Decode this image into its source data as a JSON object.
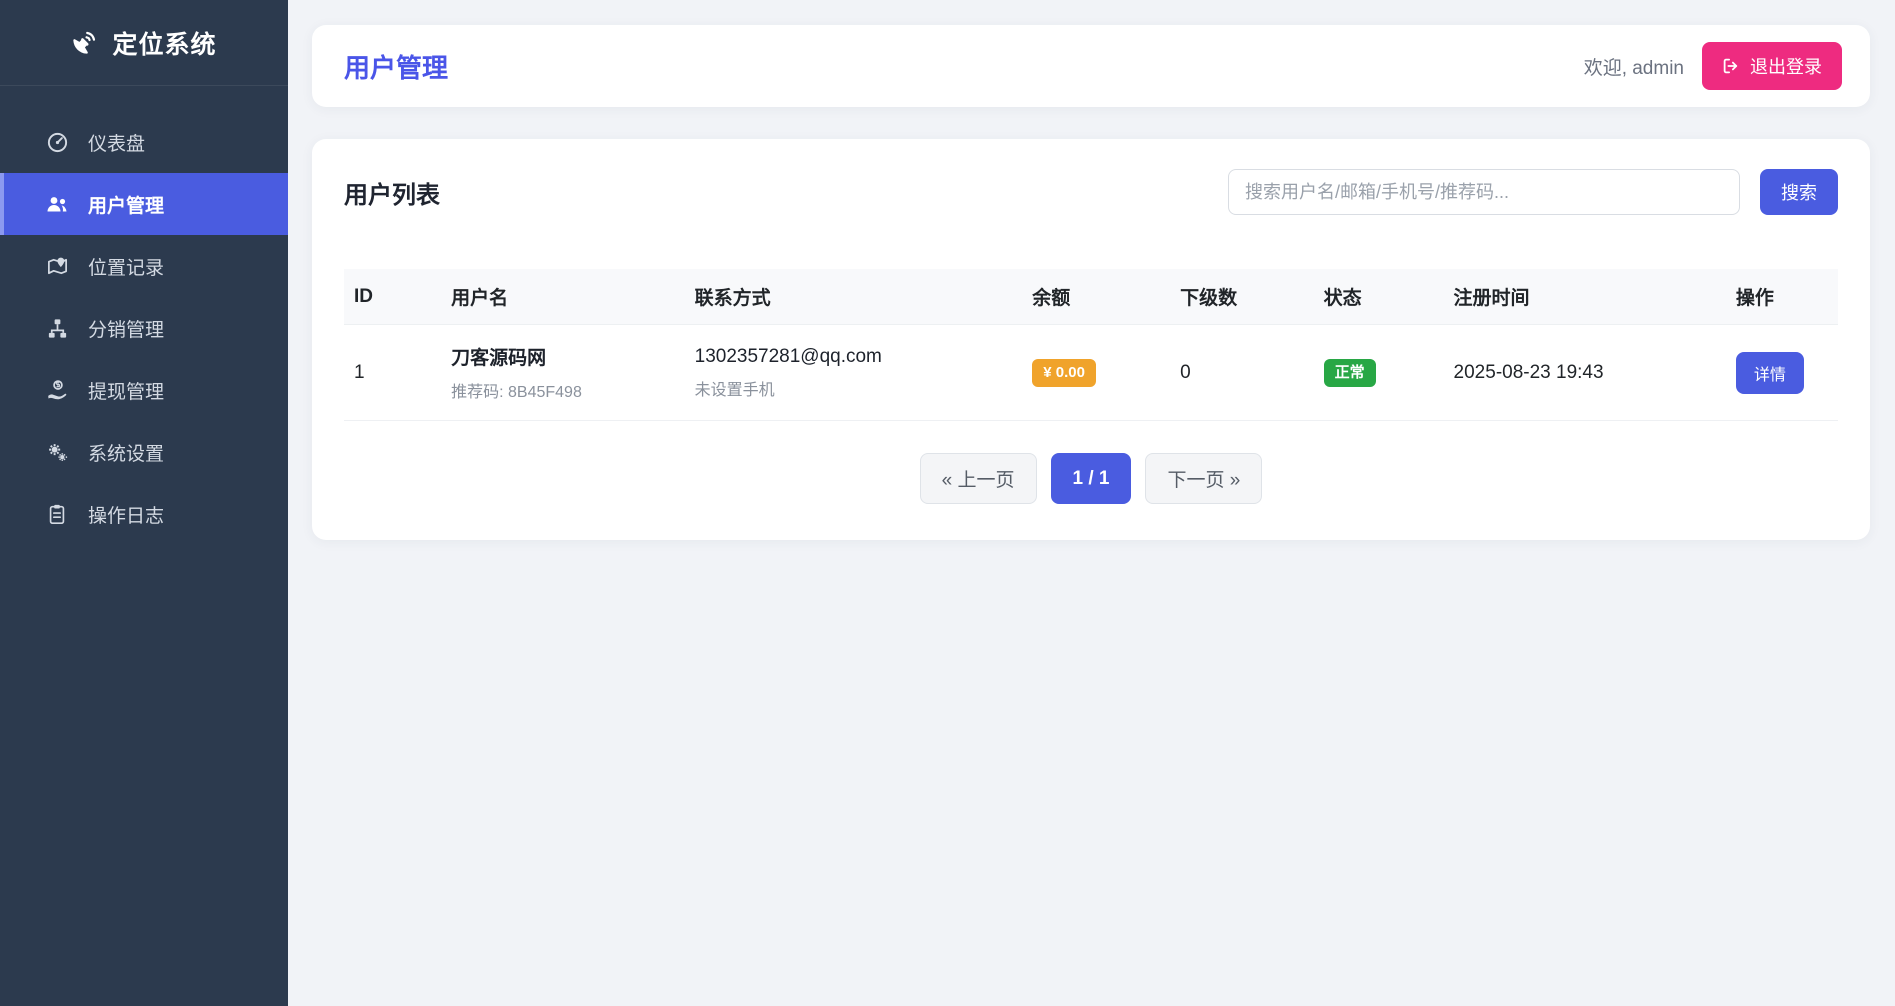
{
  "app": {
    "title": "定位系统",
    "logo_icon": "satellite-dish-icon"
  },
  "sidebar": {
    "items": [
      {
        "label": "仪表盘",
        "icon": "gauge-icon",
        "active": false
      },
      {
        "label": "用户管理",
        "icon": "users-icon",
        "active": true
      },
      {
        "label": "位置记录",
        "icon": "map-marker-icon",
        "active": false
      },
      {
        "label": "分销管理",
        "icon": "sitemap-icon",
        "active": false
      },
      {
        "label": "提现管理",
        "icon": "hand-dollar-icon",
        "active": false
      },
      {
        "label": "系统设置",
        "icon": "gears-icon",
        "active": false
      },
      {
        "label": "操作日志",
        "icon": "clipboard-icon",
        "active": false
      }
    ]
  },
  "header": {
    "title": "用户管理",
    "welcome": "欢迎, admin",
    "logout_label": "退出登录",
    "logout_icon": "sign-out-icon"
  },
  "panel": {
    "title": "用户列表",
    "search_placeholder": "搜索用户名/邮箱/手机号/推荐码...",
    "search_button": "搜索"
  },
  "table": {
    "headers": [
      "ID",
      "用户名",
      "联系方式",
      "余额",
      "下级数",
      "状态",
      "注册时间",
      "操作"
    ],
    "rows": [
      {
        "id": "1",
        "username": "刀客源码网",
        "ref_code": "推荐码: 8B45F498",
        "email": "1302357281@qq.com",
        "phone": "未设置手机",
        "balance": "¥ 0.00",
        "subordinates": "0",
        "status": "正常",
        "registered": "2025-08-23 19:43",
        "action": "详情"
      }
    ]
  },
  "pagination": {
    "prev": "« 上一页",
    "current": "1 / 1",
    "next": "下一页 »"
  },
  "colors": {
    "accent": "#4a5ce0",
    "pink": "#ee2b80",
    "orange": "#f0a32b",
    "green": "#28a745",
    "sidebar": "#2c3a4e",
    "page-bg": "#f1f3f7"
  }
}
